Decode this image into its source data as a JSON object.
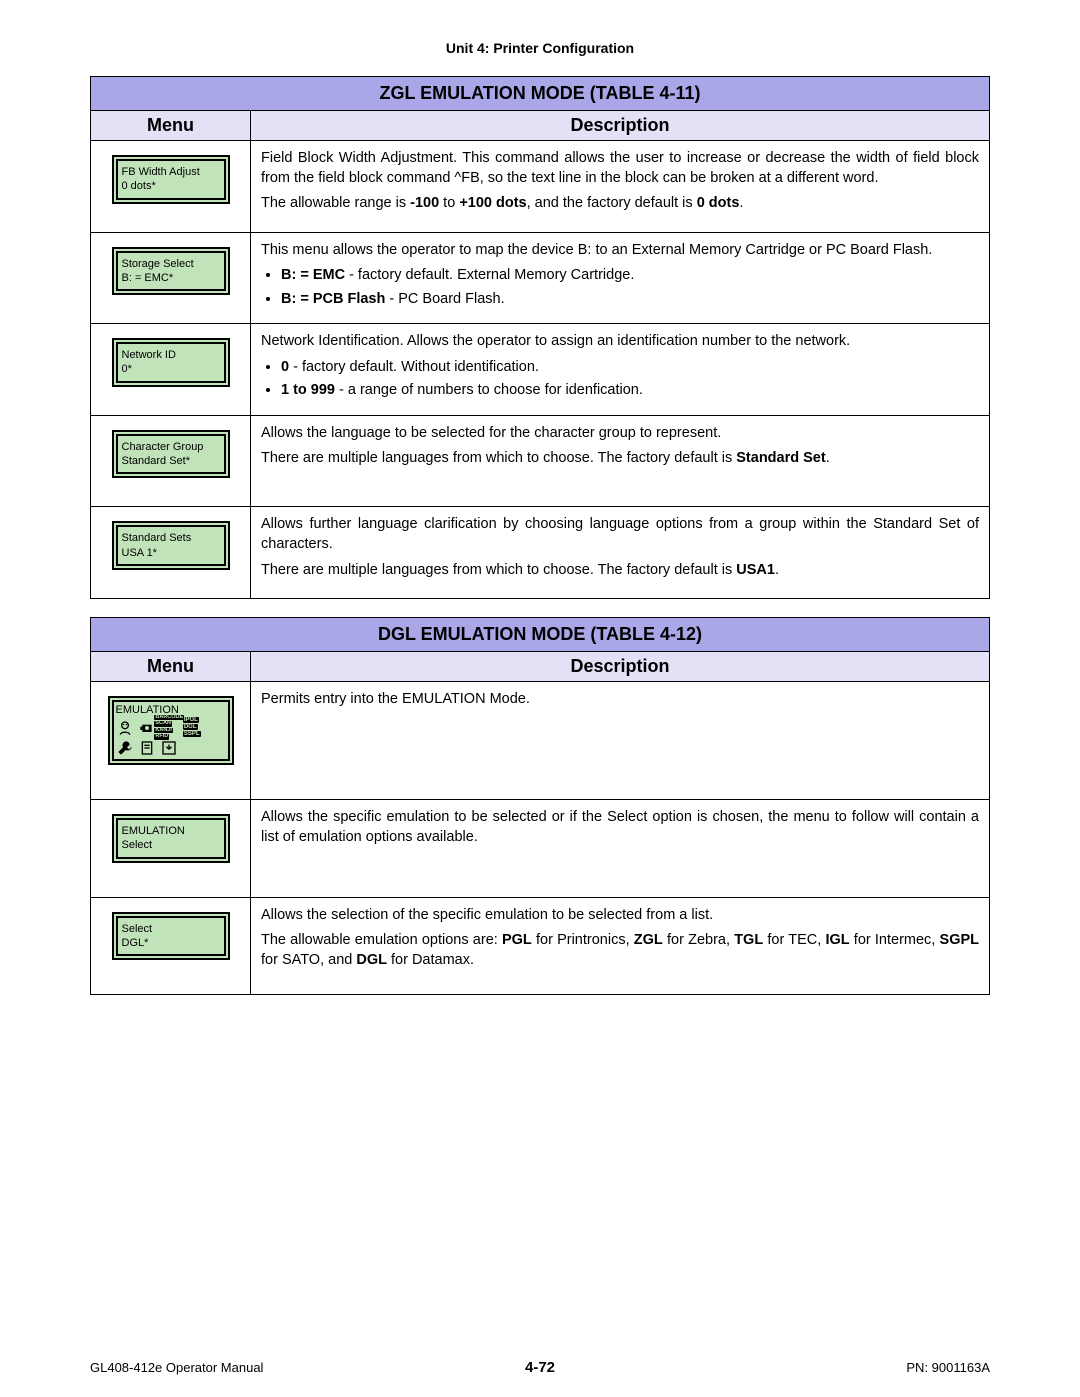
{
  "unit_header": "Unit 4:  Printer Configuration",
  "table1": {
    "title": "ZGL EMULATION MODE (TABLE 4-11)",
    "col_menu": "Menu",
    "col_desc": "Description",
    "rows": [
      {
        "lcd_l1": "FB Width Adjust",
        "lcd_l2": "0  dots*",
        "desc_html": "<p class='justify'>Field Block Width Adjustment. This command allows the user to increase or decrease the width of field block from the field block command ^FB, so the text line in the block can be broken at a different word.</p><p>The allowable range is <b>-100</b> to <b>+100 dots</b>, and the factory default is <b>0 dots</b>.</p>"
      },
      {
        "lcd_l1": "Storage Select",
        "lcd_l2": "B:  =  EMC*",
        "desc_html": "<p class='justify'>This menu allows the operator to map the device B: to an External Memory Cartridge or PC Board Flash.</p><ul><li><b>B: = EMC</b> - factory default. External Memory Cartridge.</li><li><b>B: = PCB Flash</b> - PC Board Flash.</li></ul>"
      },
      {
        "lcd_l1": "Network ID",
        "lcd_l2": "0*",
        "desc_html": "<p>Network Identification. Allows the operator to assign an identification number to the network.</p><ul><li><b>0</b> - factory default. Without identification.</li><li><b>1 to 999</b> - a range of numbers to choose for idenfication.</li></ul>"
      },
      {
        "lcd_l1": "Character Group",
        "lcd_l2": "Standard Set*",
        "desc_html": "<p>Allows the language to be selected for the character group to represent.</p><p>There are multiple languages from which to choose. The factory default is <b>Standard Set</b>.</p>"
      },
      {
        "lcd_l1": "Standard Sets",
        "lcd_l2": "USA 1*",
        "desc_html": "<p class='justify'>Allows further language clarification by choosing language options from a group within the Standard Set of characters.</p><p>There are multiple languages from which to choose. The factory default is <b>USA1</b>.</p>"
      }
    ]
  },
  "table2": {
    "title": "DGL EMULATION MODE (TABLE 4-12)",
    "col_menu": "Menu",
    "col_desc": "Description",
    "rows": [
      {
        "big": true,
        "lcd_l1": "EMULATION",
        "desc_html": "<p>Permits entry into the EMULATION Mode.</p>"
      },
      {
        "lcd_l1": "EMULATION",
        "lcd_l2": "Select",
        "desc_html": "<p class='justify'>Allows the specific emulation to be selected or if the Select option is chosen, the menu to follow will contain a list of emulation options available.</p>"
      },
      {
        "lcd_l1": "Select",
        "lcd_l2": "DGL*",
        "desc_html": "<p>Allows the selection of the specific emulation to be selected from a list.</p><p class='justify'>The allowable emulation options are: <b>PGL</b> for Printronics, <b>ZGL</b> for Zebra, <b>TGL</b> for TEC, <b>IGL</b> for Intermec, <b>SGPL</b> for SATO, and <b>DGL</b> for Datamax.</p>"
      }
    ]
  },
  "footer": {
    "left": "GL408-412e Operator Manual",
    "center": "4-72",
    "right": "PN: 9001163A"
  }
}
